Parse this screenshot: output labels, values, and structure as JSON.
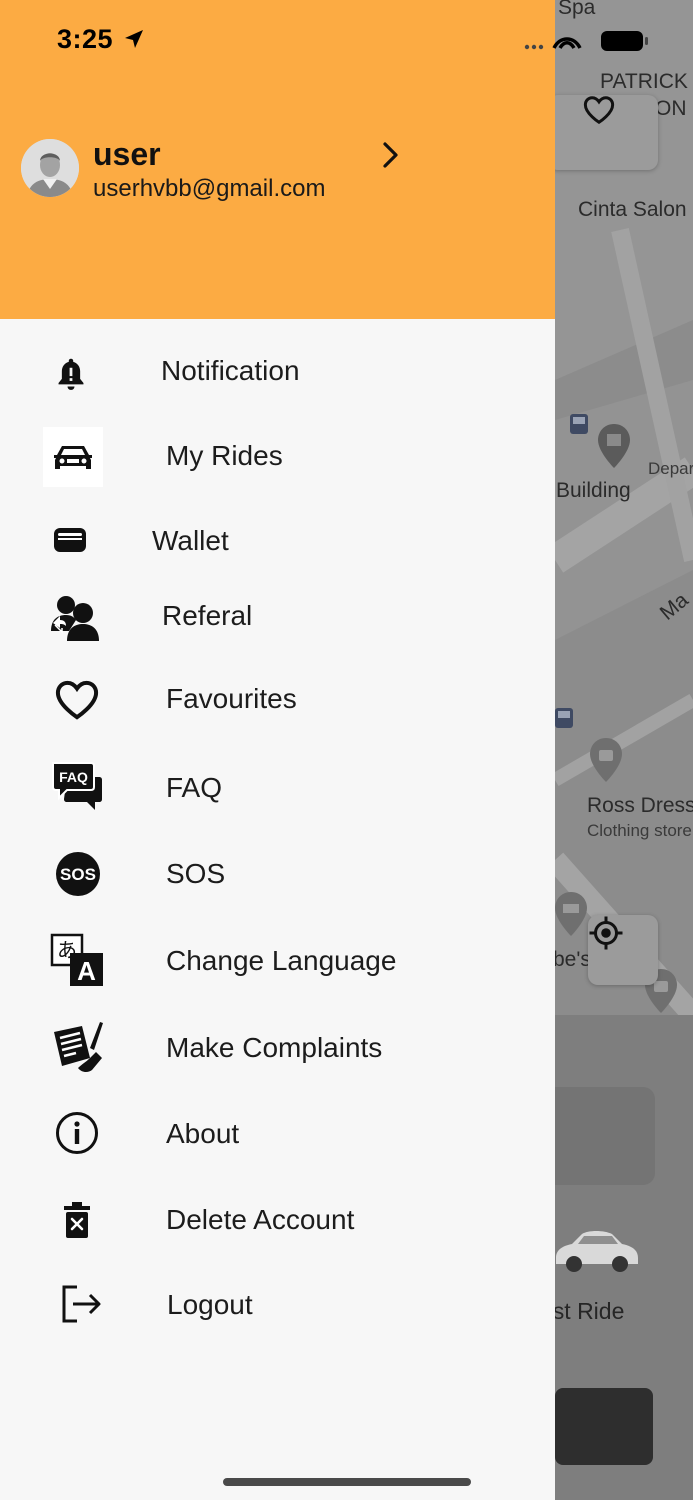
{
  "status_bar": {
    "time": "3:25"
  },
  "map": {
    "labels": [
      "Spa",
      "PATRICK",
      "ON",
      "Cinta Salon",
      "Building",
      "Depar",
      "Ross Dress",
      "Clothing store",
      "be's",
      "Ma"
    ],
    "icons": [
      "heart-icon",
      "locate-icon"
    ]
  },
  "bottom_sheet": {
    "ride_option_label": "ust Ride"
  },
  "profile": {
    "name": "user",
    "email": "userhvbb@gmail.com"
  },
  "menu": [
    {
      "label": "Notification",
      "icon": "bell-icon"
    },
    {
      "label": "My Rides",
      "icon": "car-icon"
    },
    {
      "label": "Wallet",
      "icon": "wallet-icon"
    },
    {
      "label": "Referal",
      "icon": "referral-users-icon"
    },
    {
      "label": "Favourites",
      "icon": "heart-icon"
    },
    {
      "label": "FAQ",
      "icon": "faq-icon"
    },
    {
      "label": "SOS",
      "icon": "sos-icon"
    },
    {
      "label": "Change Language",
      "icon": "translate-icon"
    },
    {
      "label": "Make Complaints",
      "icon": "complaint-icon"
    },
    {
      "label": "About",
      "icon": "info-icon"
    },
    {
      "label": "Delete Account",
      "icon": "delete-icon"
    },
    {
      "label": "Logout",
      "icon": "logout-icon"
    }
  ],
  "colors": {
    "header": "#fcab43",
    "drawer": "#f7f7f7"
  }
}
